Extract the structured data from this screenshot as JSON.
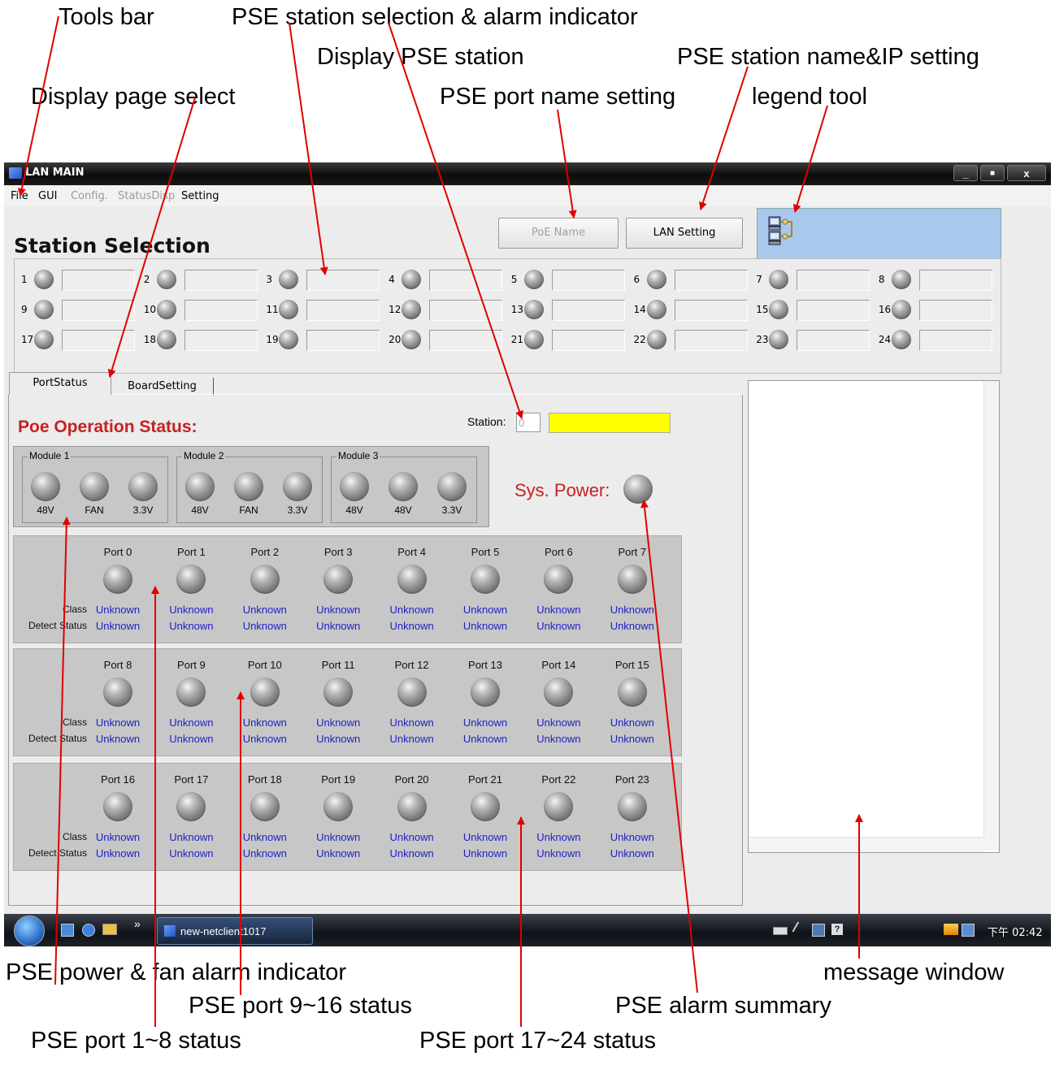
{
  "callouts": {
    "tools_bar": "Tools bar",
    "station_selection_alarm": "PSE station selection & alarm indicator",
    "display_pse_station": "Display PSE station",
    "station_name_ip": "PSE station name&IP setting",
    "display_page_select": "Display page select",
    "port_name_setting": "PSE port name setting",
    "legend_tool": "legend tool",
    "power_fan_alarm": "PSE power & fan alarm indicator",
    "message_window": "message window",
    "port_9_16": "PSE port 9~16 status",
    "alarm_summary": "PSE alarm summary",
    "port_1_8": "PSE port 1~8 status",
    "port_17_24": "PSE port 17~24 status"
  },
  "window": {
    "title": "LAN MAIN",
    "minimize": "_",
    "restore": "■",
    "close": "x"
  },
  "menu": {
    "file": "File",
    "gui": "GUI",
    "config": "Config.",
    "statusdisp": "StatusDisp",
    "setting": "Setting"
  },
  "toolbar": {
    "poe_name": "PoE Name",
    "lan_setting": "LAN Setting"
  },
  "station_selection": {
    "title": "Station Selection",
    "stations": [
      "1",
      "2",
      "3",
      "4",
      "5",
      "6",
      "7",
      "8",
      "9",
      "10",
      "11",
      "12",
      "13",
      "14",
      "15",
      "16",
      "17",
      "18",
      "19",
      "20",
      "21",
      "22",
      "23",
      "24"
    ]
  },
  "tabs": {
    "port_status": "PortStatus",
    "board_setting": "BoardSetting"
  },
  "port_status": {
    "title": "Poe Operation Status:",
    "station_label": "Station:",
    "station_value": "0",
    "station_name_color": "#ffff00",
    "sys_power_label": "Sys. Power:",
    "modules": [
      {
        "name": "Module 1",
        "indicators": [
          "48V",
          "FAN",
          "3.3V"
        ]
      },
      {
        "name": "Module 2",
        "indicators": [
          "48V",
          "FAN",
          "3.3V"
        ]
      },
      {
        "name": "Module 3",
        "indicators": [
          "48V",
          "48V",
          "3.3V"
        ]
      }
    ],
    "class_label": "Class",
    "detect_label": "Detect Status",
    "port_groups": [
      {
        "ports": [
          {
            "name": "Port 0",
            "class": "Unknown",
            "detect": "Unknown"
          },
          {
            "name": "Port 1",
            "class": "Unknown",
            "detect": "Unknown"
          },
          {
            "name": "Port 2",
            "class": "Unknown",
            "detect": "Unknown"
          },
          {
            "name": "Port 3",
            "class": "Unknown",
            "detect": "Unknown"
          },
          {
            "name": "Port 4",
            "class": "Unknown",
            "detect": "Unknown"
          },
          {
            "name": "Port 5",
            "class": "Unknown",
            "detect": "Unknown"
          },
          {
            "name": "Port 6",
            "class": "Unknown",
            "detect": "Unknown"
          },
          {
            "name": "Port 7",
            "class": "Unknown",
            "detect": "Unknown"
          }
        ]
      },
      {
        "ports": [
          {
            "name": "Port 8",
            "class": "Unknown",
            "detect": "Unknown"
          },
          {
            "name": "Port 9",
            "class": "Unknown",
            "detect": "Unknown"
          },
          {
            "name": "Port 10",
            "class": "Unknown",
            "detect": "Unknown"
          },
          {
            "name": "Port 11",
            "class": "Unknown",
            "detect": "Unknown"
          },
          {
            "name": "Port 12",
            "class": "Unknown",
            "detect": "Unknown"
          },
          {
            "name": "Port 13",
            "class": "Unknown",
            "detect": "Unknown"
          },
          {
            "name": "Port 14",
            "class": "Unknown",
            "detect": "Unknown"
          },
          {
            "name": "Port 15",
            "class": "Unknown",
            "detect": "Unknown"
          }
        ]
      },
      {
        "ports": [
          {
            "name": "Port 16",
            "class": "Unknown",
            "detect": "Unknown"
          },
          {
            "name": "Port 17",
            "class": "Unknown",
            "detect": "Unknown"
          },
          {
            "name": "Port 18",
            "class": "Unknown",
            "detect": "Unknown"
          },
          {
            "name": "Port 19",
            "class": "Unknown",
            "detect": "Unknown"
          },
          {
            "name": "Port 20",
            "class": "Unknown",
            "detect": "Unknown"
          },
          {
            "name": "Port 21",
            "class": "Unknown",
            "detect": "Unknown"
          },
          {
            "name": "Port 22",
            "class": "Unknown",
            "detect": "Unknown"
          },
          {
            "name": "Port 23",
            "class": "Unknown",
            "detect": "Unknown"
          }
        ]
      }
    ]
  },
  "taskbar": {
    "overflow": "»",
    "task_label": "new-netclient1017",
    "clock": "下午 02:42"
  },
  "colors": {
    "alarm_red": "#c82020",
    "value_blue": "#2020c8",
    "legend_panel": "#a9c8ec",
    "arrow": "#e00000"
  }
}
